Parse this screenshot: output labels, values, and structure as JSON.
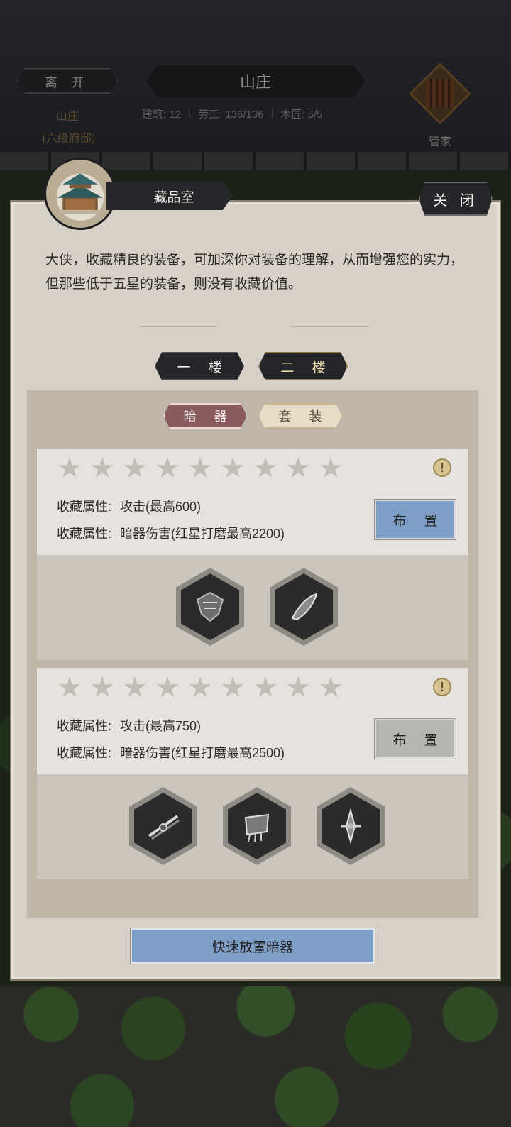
{
  "header": {
    "leave_label": "离 开",
    "estate_name": "山庄",
    "estate_rank": "(六级府邸)",
    "title": "山庄",
    "stats": {
      "buildings": "建筑: 12",
      "labor": "劳工: 136/136",
      "carpenters": "木匠: 5/5"
    },
    "steward_label": "管家"
  },
  "modal": {
    "title": "藏品室",
    "close_label": "关 闭",
    "description": "大侠，收藏精良的装备，可加深你对装备的理解，从而增强您的实力，但那些低于五星的装备，则没有收藏价值。",
    "floors": [
      "一 楼",
      "二 楼"
    ],
    "active_floor": "二 楼",
    "categories": [
      "暗 器",
      "套 装"
    ],
    "active_category": "暗 器",
    "cards": [
      {
        "stars": 9,
        "attrs": [
          {
            "key": "收藏属性:",
            "value": "攻击(最高600)"
          },
          {
            "key": "收藏属性:",
            "value": "暗器伤害(红星打磨最高2200)"
          }
        ],
        "place_label": "布 置",
        "place_active": true,
        "items": [
          "hidden-weapon-1",
          "hidden-weapon-2"
        ]
      },
      {
        "stars": 9,
        "attrs": [
          {
            "key": "收藏属性:",
            "value": "攻击(最高750)"
          },
          {
            "key": "收藏属性:",
            "value": "暗器伤害(红星打磨最高2500)"
          }
        ],
        "place_label": "布 置",
        "place_active": false,
        "items": [
          "hidden-weapon-3",
          "hidden-weapon-4",
          "hidden-weapon-5"
        ]
      }
    ],
    "quick_place_label": "快速放置暗器"
  },
  "colors": {
    "active_blue": "#7d9ec7",
    "inactive_gray": "#b7b5b1",
    "active_tab": "#8a5a5e",
    "panel_bg": "#d6d0c6"
  }
}
